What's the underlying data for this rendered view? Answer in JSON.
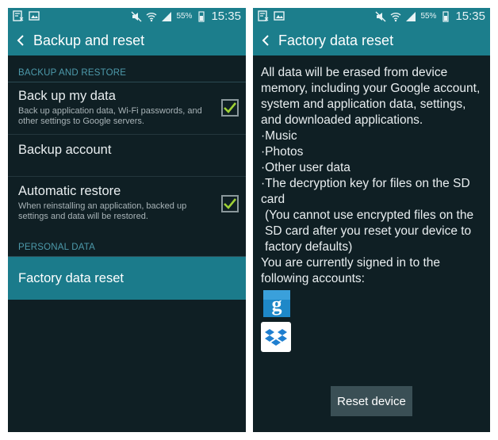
{
  "status_bar": {
    "battery_percent": "55%",
    "time": "15:35"
  },
  "left_screen": {
    "title": "Backup and reset",
    "section_backup": "BACKUP AND RESTORE",
    "backup_my_data": {
      "title": "Back up my data",
      "subtitle": "Back up application data, Wi-Fi passwords, and other settings to Google servers.",
      "checked": true
    },
    "backup_account": {
      "title": "Backup account"
    },
    "automatic_restore": {
      "title": "Automatic restore",
      "subtitle": "When reinstalling an application, backed up settings and data will be restored.",
      "checked": true
    },
    "section_personal": "PERSONAL DATA",
    "factory_reset_item": "Factory data reset"
  },
  "right_screen": {
    "title": "Factory data reset",
    "intro": "All data will be erased from device memory, including your Google account, system and application data, settings, and downloaded applications.",
    "bullets": [
      "Music",
      "Photos",
      "Other user data",
      "The decryption key for files on the SD card"
    ],
    "bullet_note": "(You cannot use encrypted files on the SD card after you reset your device to factory defaults)",
    "accounts_text": "You are currently signed in to the following accounts:",
    "accounts": [
      "google-account-icon",
      "dropbox-account-icon"
    ],
    "reset_button": "Reset device"
  },
  "colors": {
    "accent": "#1c7e8c",
    "background": "#0f1f24",
    "checkmark": "#9fd136",
    "section_header": "#4d9aab"
  }
}
